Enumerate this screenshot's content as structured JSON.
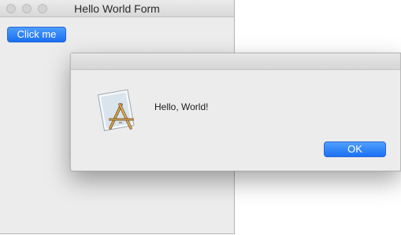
{
  "main_window": {
    "title": "Hello World Form",
    "click_button_label": "Click me"
  },
  "dialog": {
    "message": "Hello, World!",
    "ok_label": "OK",
    "icon": "app-icon"
  },
  "colors": {
    "accent": "#1a6ff2",
    "window_bg": "#ececec"
  }
}
